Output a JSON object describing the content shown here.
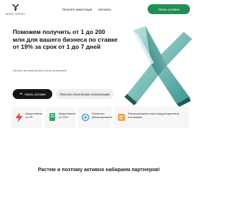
{
  "header": {
    "logo_text": "MOOS CAPITAL",
    "nav": [
      "Получить инвестиции",
      "Контакты"
    ],
    "cta_label": "Узнать условия"
  },
  "hero": {
    "title": "Поможем получить от 1 до 200 млн для вашего бизнеса по ставке от 19% за срок от 1 до 7 дней",
    "subtitle": "Оплата за наши услуги после результата",
    "primary_button": "Узнать условия",
    "secondary_button": "Получить бесплатную консультацию"
  },
  "cards": [
    {
      "label": "Кредитование по ИП",
      "icon": "lightning-icon"
    },
    {
      "label": "Кредитование по ООО",
      "icon": "document-icon"
    },
    {
      "label": "Проектное финансирование",
      "icon": "circle-icon"
    },
    {
      "label": "Финансирование через краудлендинговые платформы",
      "icon": "crowd-icon"
    }
  ],
  "section": {
    "title": "Растем и поэтому активно набираем партнеров!"
  },
  "colors": {
    "accent": "#1f8f55",
    "dark_button": "#151515",
    "decor": "#4fb8b0"
  }
}
